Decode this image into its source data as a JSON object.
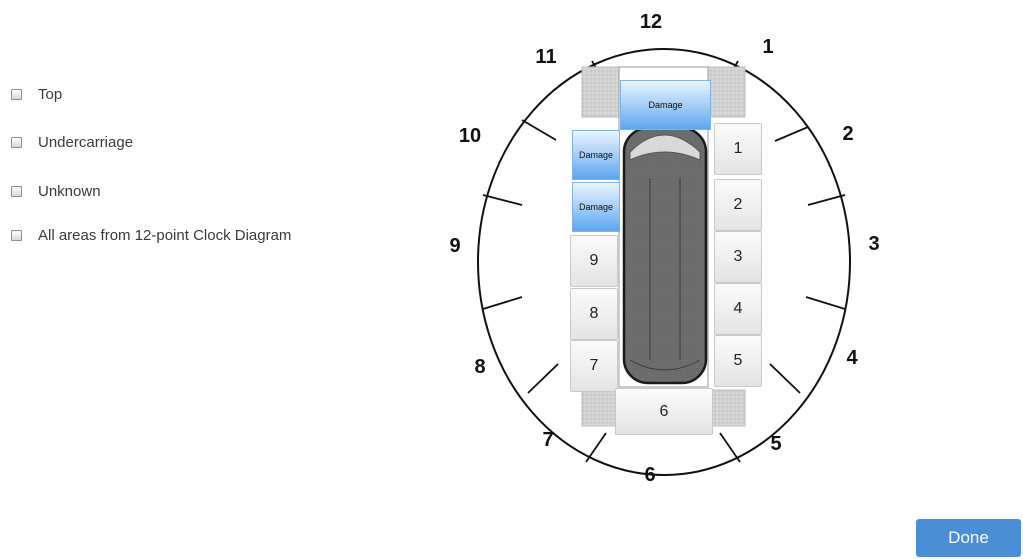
{
  "options": [
    {
      "label": "Top",
      "checked": false
    },
    {
      "label": "Undercarriage",
      "checked": false
    },
    {
      "label": "Unknown",
      "checked": false
    },
    {
      "label": "All areas from 12-point Clock Diagram",
      "checked": false
    }
  ],
  "clock_labels": [
    "12",
    "1",
    "2",
    "3",
    "4",
    "5",
    "6",
    "7",
    "8",
    "9",
    "10",
    "11"
  ],
  "right_tiles": [
    "1",
    "2",
    "3",
    "4",
    "5"
  ],
  "left_tiles": [
    "9",
    "8",
    "7"
  ],
  "bottom_tile": "6",
  "damage_markers": {
    "front": "Damage",
    "left_front": "Damage",
    "left_middle": "Damage"
  },
  "done_label": "Done",
  "colors": {
    "accent": "#4a8fd6",
    "damage": "#5aa6f0"
  }
}
